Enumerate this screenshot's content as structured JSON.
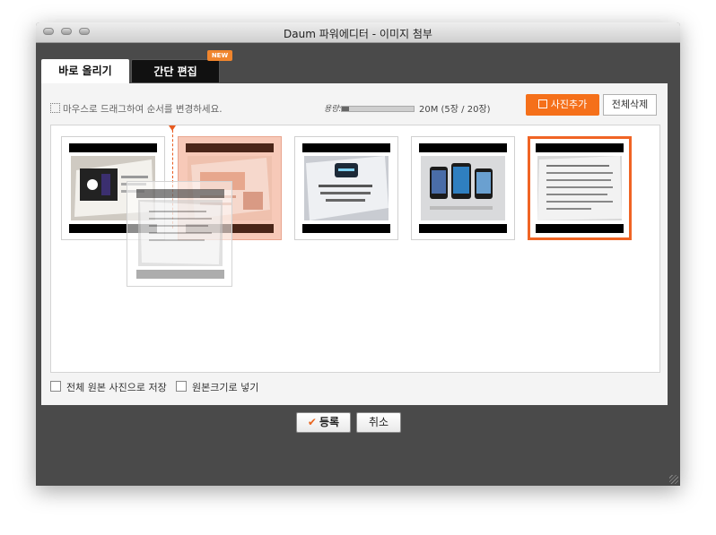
{
  "window": {
    "title": "Daum 파워에디터 - 이미지 첨부"
  },
  "tabs": [
    {
      "label": "바로 올리기",
      "active": true
    },
    {
      "label": "간단 편집",
      "active": false,
      "badge": "NEW"
    }
  ],
  "toolbar": {
    "hint": "마우스로 드래그하여 순서를 변경하세요.",
    "capacity_label": "용량:",
    "capacity_text": "20M (5장 / 20장)",
    "capacity_fraction": 0.1,
    "add_photo_label": "사진추가",
    "delete_all_label": "전체삭제"
  },
  "thumbnails": [
    {
      "name": "photo-apple-keynote",
      "state": "normal"
    },
    {
      "name": "photo-google-book",
      "state": "dragging"
    },
    {
      "name": "photo-dark-screen-text",
      "state": "normal"
    },
    {
      "name": "photo-iphones",
      "state": "normal"
    },
    {
      "name": "photo-text-page",
      "state": "selected"
    }
  ],
  "options": {
    "save_original_label": "전체 원본 사진으로 저장",
    "insert_original_label": "원본크기로 넣기"
  },
  "buttons": {
    "ok_label": "등록",
    "cancel_label": "취소"
  },
  "colors": {
    "accent": "#f5701a",
    "selected_border": "#f06424",
    "window_bg": "#4a4a4a"
  }
}
